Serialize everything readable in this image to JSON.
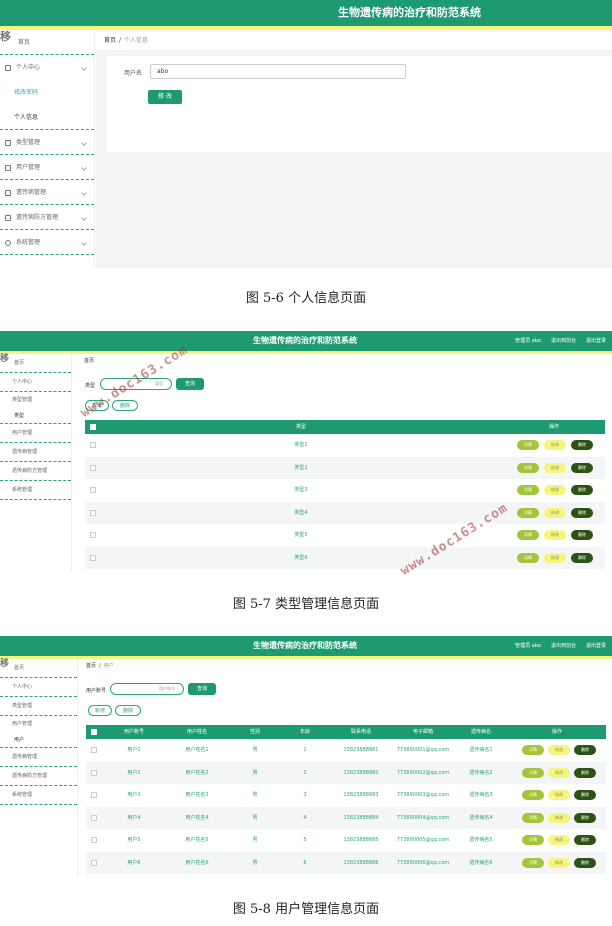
{
  "app_title": "生物遗传病的治疗和防范系统",
  "header_links": [
    "管理员 abo",
    "退出到前台",
    "退出登录"
  ],
  "home": "首页",
  "sidebar": {
    "home": "首页",
    "personal": "个人中心",
    "change_password": "修改密码",
    "profile": "个人信息",
    "category": "类型管理",
    "users": "用户管理",
    "diseases": "遗传病管理",
    "prevention": "遗传病防方管理",
    "system": "系统管理",
    "category_sub": "类型",
    "users_sub": "用户"
  },
  "screen1": {
    "crumb_current": "个人信息",
    "field_label": "用户名",
    "field_value": "abo",
    "submit": "修 改",
    "caption": "图 5-6 个人信息页面"
  },
  "screen2": {
    "crumb": "首页",
    "search_label": "类型",
    "search_placeholder": "类型",
    "query": "查询",
    "add": "新增",
    "delete": "删除",
    "columns": [
      "类型",
      "操作"
    ],
    "rows": [
      "类型1",
      "类型2",
      "类型3",
      "类型4",
      "类型5",
      "类型6"
    ],
    "ops": [
      "详情",
      "修改",
      "删除"
    ],
    "caption": "图 5-7 类型管理信息页面"
  },
  "screen3": {
    "crumb_current": "用户",
    "search_label": "用户账号",
    "search_placeholder": "用户账号",
    "query": "查询",
    "add": "新增",
    "delete": "删除",
    "columns": [
      "用户账号",
      "用户姓名",
      "性别",
      "年龄",
      "联系电话",
      "电子邮箱",
      "遗传病名",
      "操作"
    ],
    "rows": [
      [
        "用户1",
        "用户姓名1",
        "男",
        "1",
        "13823888881",
        "773890001@qq.com",
        "遗传病名1"
      ],
      [
        "用户2",
        "用户姓名2",
        "男",
        "2",
        "13823888882",
        "773890002@qq.com",
        "遗传病名2"
      ],
      [
        "用户3",
        "用户姓名3",
        "男",
        "3",
        "13823888883",
        "773890003@qq.com",
        "遗传病名3"
      ],
      [
        "用户4",
        "用户姓名4",
        "男",
        "4",
        "13823888884",
        "773890004@qq.com",
        "遗传病名4"
      ],
      [
        "用户5",
        "用户姓名5",
        "男",
        "5",
        "13823888885",
        "773890005@qq.com",
        "遗传病名5"
      ],
      [
        "用户6",
        "用户姓名6",
        "男",
        "6",
        "13823888886",
        "773890006@qq.com",
        "遗传病名6"
      ]
    ],
    "ops": [
      "详情",
      "修改",
      "删除"
    ],
    "caption": "图 5-8 用户管理信息页面"
  },
  "watermark": "www.doc163.com",
  "colors": {
    "primary": "#1e9a73",
    "yellow": "#f5f57a",
    "view": "#a4c43a",
    "danger": "#2d5216"
  }
}
